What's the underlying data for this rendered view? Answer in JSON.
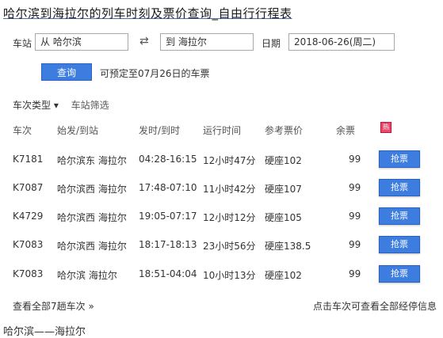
{
  "page_title": "哈尔滨到海拉尔的列车时刻及票价查询_自由行行程表",
  "form": {
    "from_label": "车站",
    "from_value": "从 哈尔滨",
    "swap_icon": "swap-icon",
    "to_value": "到 海拉尔",
    "date_label": "日期",
    "date_value": "2018-06-26(周二)"
  },
  "query_button_label": "查询",
  "presale_note": "可预定至07月26日的车票",
  "filters": {
    "train_type": "车次类型 ▾",
    "station_filter": "车站筛选"
  },
  "table": {
    "headers": {
      "train_no": "车次",
      "stations": "始发/到站",
      "times": "发时/到时",
      "duration": "运行时间",
      "price": "参考票价",
      "remaining": "余票",
      "badge": "热"
    },
    "rows": [
      {
        "train_no": "K7181",
        "stations": "哈尔滨东 海拉尔",
        "times": "04:28-16:15",
        "duration": "12小时47分",
        "price": "硬座102",
        "remaining": "99",
        "button": "抢票"
      },
      {
        "train_no": "K7087",
        "stations": "哈尔滨西 海拉尔",
        "times": "17:48-07:10",
        "duration": "11小时42分",
        "price": "硬座107",
        "remaining": "99",
        "button": "抢票"
      },
      {
        "train_no": "K4729",
        "stations": "哈尔滨西 海拉尔",
        "times": "19:05-07:17",
        "duration": "12小时12分",
        "price": "硬座105",
        "remaining": "99",
        "button": "抢票"
      },
      {
        "train_no": "K7083",
        "stations": "哈尔滨西 海拉尔",
        "times": "18:17-18:13",
        "duration": "23小时56分",
        "price": "硬座138.5",
        "remaining": "99",
        "button": "抢票"
      },
      {
        "train_no": "K7083",
        "stations": "哈尔滨 海拉尔",
        "times": "18:51-04:04",
        "duration": "10小时13分",
        "price": "硬座102",
        "remaining": "99",
        "button": "抢票"
      }
    ]
  },
  "footer": {
    "view_all": "查看全部7趟车次 »",
    "view_all_note": "点击车次可查看全部经停信息"
  },
  "bottom_fragment": "哈尔滨——海拉尔"
}
